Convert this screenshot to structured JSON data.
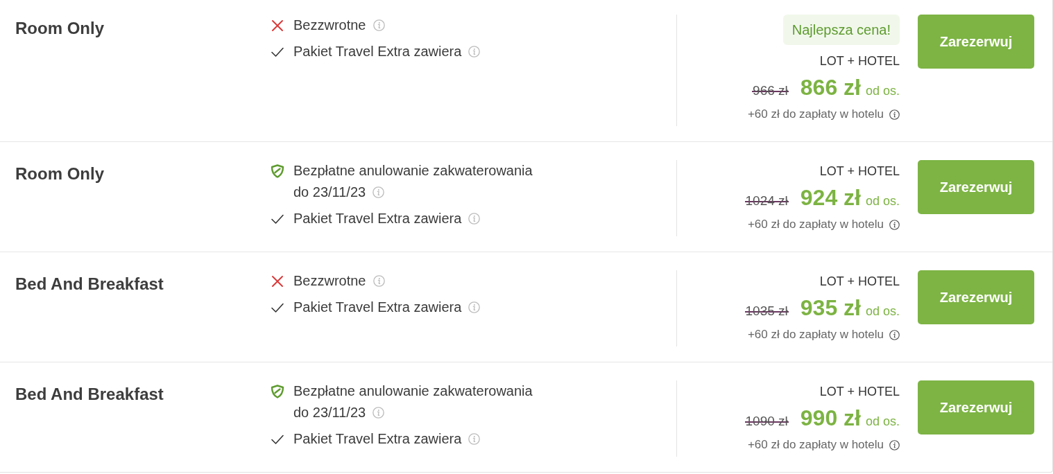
{
  "offers": [
    {
      "board": "Room Only",
      "features": [
        {
          "kind": "non_refundable",
          "text": "Bezzwrotne"
        },
        {
          "kind": "included",
          "text": "Pakiet Travel Extra zawiera"
        }
      ],
      "badge": "Najlepsza cena!",
      "package": "LOT + HOTEL",
      "old_price": "966 zł",
      "price": "866 zł",
      "price_unit": "od os.",
      "extra_fee": "+60 zł do zapłaty w hotelu",
      "button": "Zarezerwuj"
    },
    {
      "board": "Room Only",
      "features": [
        {
          "kind": "free_cancellation",
          "text": "Bezpłatne anulowanie zakwaterowania",
          "until": "do 23/11/23"
        },
        {
          "kind": "included",
          "text": "Pakiet Travel Extra zawiera"
        }
      ],
      "package": "LOT + HOTEL",
      "old_price": "1024 zł",
      "price": "924 zł",
      "price_unit": "od os.",
      "extra_fee": "+60 zł do zapłaty w hotelu",
      "button": "Zarezerwuj"
    },
    {
      "board": "Bed And Breakfast",
      "features": [
        {
          "kind": "non_refundable",
          "text": "Bezzwrotne"
        },
        {
          "kind": "included",
          "text": "Pakiet Travel Extra zawiera"
        }
      ],
      "package": "LOT + HOTEL",
      "old_price": "1035 zł",
      "price": "935 zł",
      "price_unit": "od os.",
      "extra_fee": "+60 zł do zapłaty w hotelu",
      "button": "Zarezerwuj"
    },
    {
      "board": "Bed And Breakfast",
      "features": [
        {
          "kind": "free_cancellation",
          "text": "Bezpłatne anulowanie zakwaterowania",
          "until": "do 23/11/23"
        },
        {
          "kind": "included",
          "text": "Pakiet Travel Extra zawiera"
        }
      ],
      "package": "LOT + HOTEL",
      "old_price": "1090 zł",
      "price": "990 zł",
      "price_unit": "od os.",
      "extra_fee": "+60 zł do zapłaty w hotelu",
      "button": "Zarezerwuj"
    }
  ]
}
